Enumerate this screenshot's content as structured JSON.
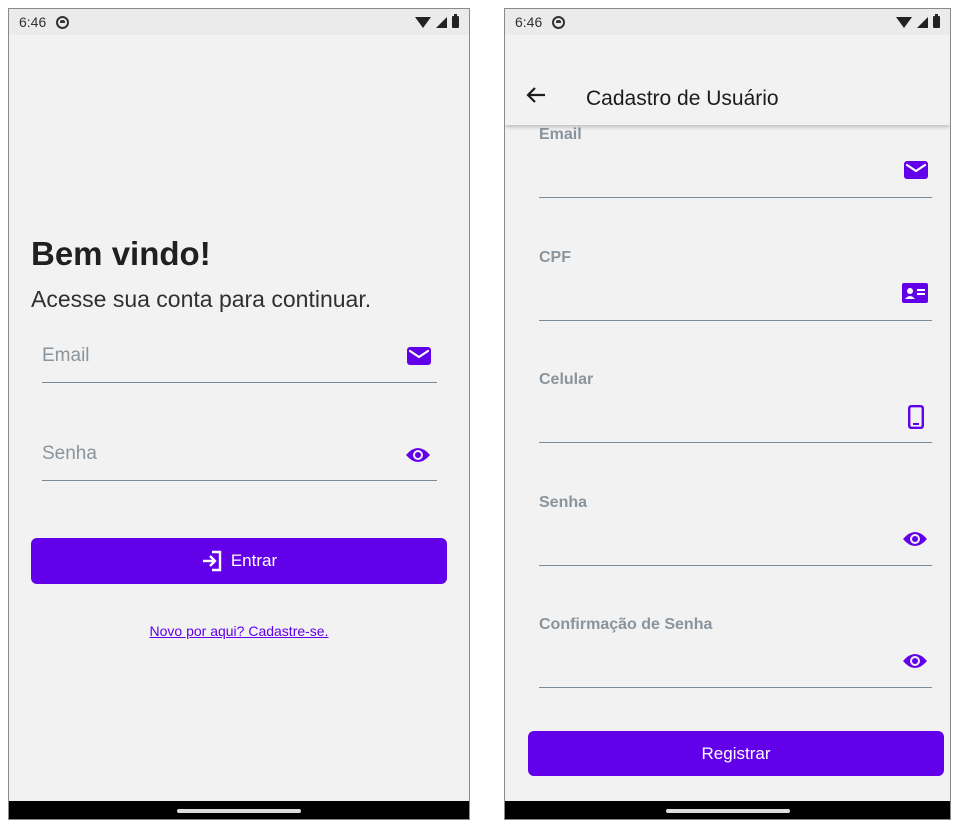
{
  "login_screen": {
    "status_bar": {
      "time": "6:46"
    },
    "welcome_title": "Bem vindo!",
    "subtitle": "Acesse sua conta para continuar.",
    "email_field": {
      "placeholder": "Email",
      "icon": "envelope-icon"
    },
    "password_field": {
      "placeholder": "Senha",
      "icon": "eye-icon"
    },
    "login_button": {
      "label": "Entrar",
      "icon": "login-icon"
    },
    "signup_link": "Novo por aqui? Cadastre-se."
  },
  "register_screen": {
    "status_bar": {
      "time": "6:46"
    },
    "app_bar": {
      "title": "Cadastro de Usuário",
      "back_icon": "arrow-left-icon"
    },
    "fields": {
      "email": {
        "label": "Email",
        "icon": "envelope-icon"
      },
      "cpf": {
        "label": "CPF",
        "icon": "id-card-icon"
      },
      "phone": {
        "label": "Celular",
        "icon": "smartphone-icon"
      },
      "password": {
        "label": "Senha",
        "icon": "eye-icon"
      },
      "confirm_password": {
        "label": "Confirmação de Senha",
        "icon": "eye-icon"
      }
    },
    "register_button": {
      "label": "Registrar"
    }
  },
  "colors": {
    "accent": "#6200ea",
    "background": "#f2f2f2",
    "field_text": "#8a949c",
    "underline": "#7a8a96"
  }
}
